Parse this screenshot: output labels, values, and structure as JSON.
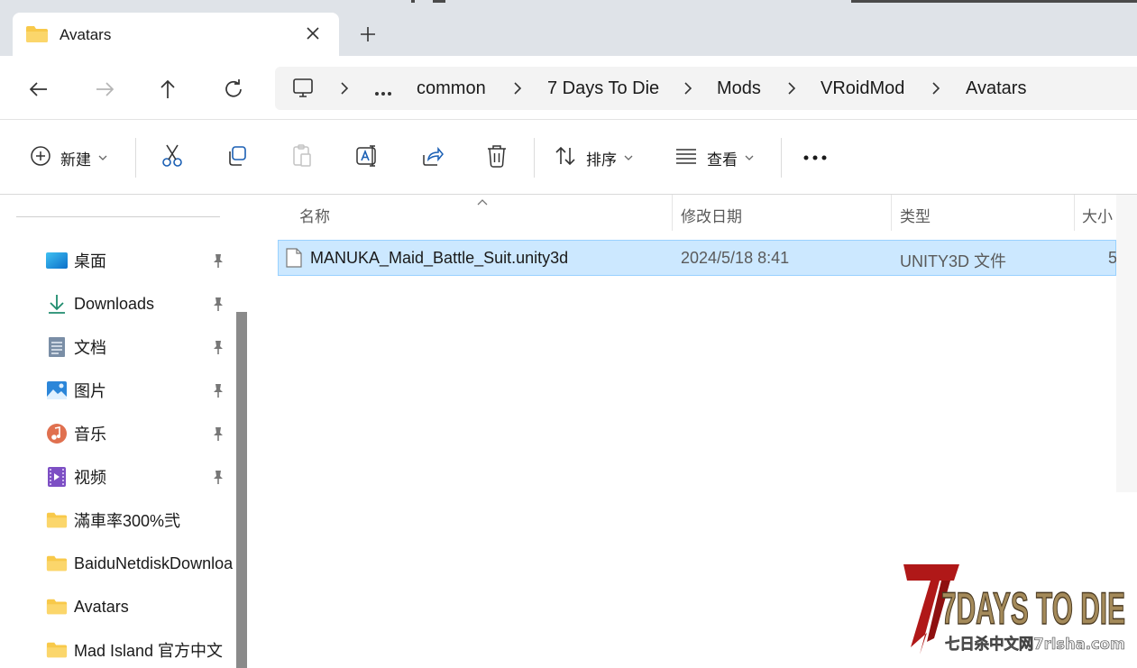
{
  "tab": {
    "title": "Avatars"
  },
  "breadcrumb": [
    "common",
    "7 Days To Die",
    "Mods",
    "VRoidMod",
    "Avatars"
  ],
  "toolbar": {
    "new_label": "新建",
    "sort_label": "排序",
    "view_label": "查看"
  },
  "sidebar": {
    "items": [
      {
        "label": "桌面",
        "icon": "desktop-icon",
        "pinned": true
      },
      {
        "label": "Downloads",
        "icon": "download-icon",
        "pinned": true
      },
      {
        "label": "文档",
        "icon": "documents-icon",
        "pinned": true
      },
      {
        "label": "图片",
        "icon": "pictures-icon",
        "pinned": true
      },
      {
        "label": "音乐",
        "icon": "music-icon",
        "pinned": true
      },
      {
        "label": "视频",
        "icon": "videos-icon",
        "pinned": true
      },
      {
        "label": "滿車率300%弐",
        "icon": "folder-icon",
        "pinned": false
      },
      {
        "label": "BaiduNetdiskDownload",
        "icon": "folder-icon",
        "pinned": false
      },
      {
        "label": "Avatars",
        "icon": "folder-icon",
        "pinned": false
      },
      {
        "label": "Mad Island 官方中文",
        "icon": "folder-icon",
        "pinned": false
      }
    ]
  },
  "columns": {
    "name": "名称",
    "date": "修改日期",
    "type": "类型",
    "size": "大小"
  },
  "files": [
    {
      "name": "MANUKA_Maid_Battle_Suit.unity3d",
      "date": "2024/5/18 8:41",
      "type": "UNITY3D 文件",
      "size": "5"
    }
  ],
  "watermark": {
    "logo_text": "7DAYS TO DIE",
    "sub_text": "七日杀中文网7rlsha.com"
  },
  "colors": {
    "selection": "#cce8ff",
    "selection_border": "#99d1ff",
    "folder": "#f8c94a",
    "accent": "#0067c0"
  }
}
